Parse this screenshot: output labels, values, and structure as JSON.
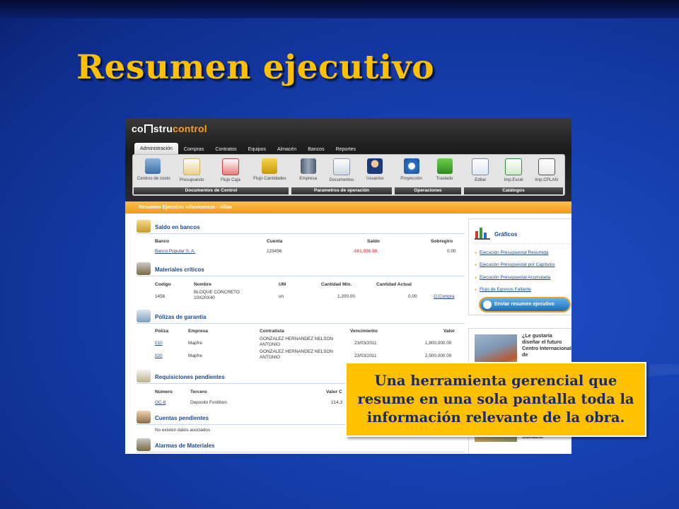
{
  "slide": {
    "title": "Resumen ejecutivo",
    "callout": "Una herramienta gerencial que resume en una sola pantalla toda la información relevante de la obra."
  },
  "app": {
    "logo_pre": "co",
    "logo_mid": "stru",
    "logo_accent": "control",
    "tabs": [
      "Administración",
      "Compras",
      "Contratos",
      "Equipos",
      "Almacén",
      "Bancos",
      "Reportes"
    ],
    "ribbon": {
      "documentos": {
        "label": "Documentos de Control",
        "tools": [
          "Centros de costo",
          "Presupuesto",
          "Flujo Caja",
          "Flujo Cantidades"
        ]
      },
      "parametros": {
        "label": "Parametros de operación",
        "tools": [
          "Empresa",
          "Documentos",
          "Usuarios"
        ]
      },
      "operaciones": {
        "label": "Operaciones",
        "tools": [
          "Proyección",
          "Traslado"
        ]
      },
      "catalogos": {
        "label": "Catálogos",
        "tools": [
          "Editar",
          "Imp.Excel",
          "Imp.CPLAN"
        ]
      }
    },
    "page_header": "Resumen Ejecutivo villavicencio - villao"
  },
  "saldo": {
    "title": "Saldo en bancos",
    "headers": [
      "Banco",
      "Cuenta",
      "Saldo",
      "Sobregiro"
    ],
    "rows": [
      [
        "Banco Popular S. A.",
        "123456",
        "-681,936.98",
        "0.00"
      ]
    ]
  },
  "materiales": {
    "title": "Materiales críticos",
    "headers": [
      "Codigo",
      "Nombre",
      "UM",
      "Cantidad Mín.",
      "Cantidad Actual"
    ],
    "rows": [
      [
        "1456",
        "BLOQUE CONCRETO 10X20X40",
        "un",
        "1,200.00",
        "0.00",
        "O.Compra"
      ]
    ]
  },
  "polizas": {
    "title": "Pólizas de garantía",
    "headers": [
      "Póliza",
      "Empresa",
      "Contratista",
      "Vencimiento",
      "Valor"
    ],
    "rows": [
      [
        "010",
        "Mapfre",
        "GONZALEZ HERNANDEZ NELSON ANTONIO",
        "23/03/2011",
        "1,800,000.00"
      ],
      [
        "020",
        "Mapfre",
        "GONZALEZ HERNANDEZ NELSON ANTONIO",
        "23/03/2011",
        "2,500,000.00"
      ]
    ]
  },
  "requisiciones": {
    "title": "Requisiciones pendientes",
    "headers": [
      "Número",
      "Tercero",
      "Valor C"
    ],
    "rows": [
      [
        "OC-8",
        "Deposito Fontibon",
        "214,3"
      ]
    ]
  },
  "cuentas": {
    "title": "Cuentas pendientes",
    "empty": "No existen datos asociados"
  },
  "alarmas": {
    "title": "Alarmas de Materiales"
  },
  "side": {
    "graficos_title": "Gráficos",
    "links": [
      "Ejecución Presupuestal Resumida",
      "Ejecución Presupuestal por Capítulos",
      "Ejecución Presupuestal Acumulada",
      "Flujo de Egresos Faltante"
    ],
    "send_button": "Enviar resumen ejecutivo",
    "ad_text": "¿Le gustaría diseñar el futuro Centro Internacional de",
    "ad_text2": "vivienda nueva\" : Camacol"
  }
}
